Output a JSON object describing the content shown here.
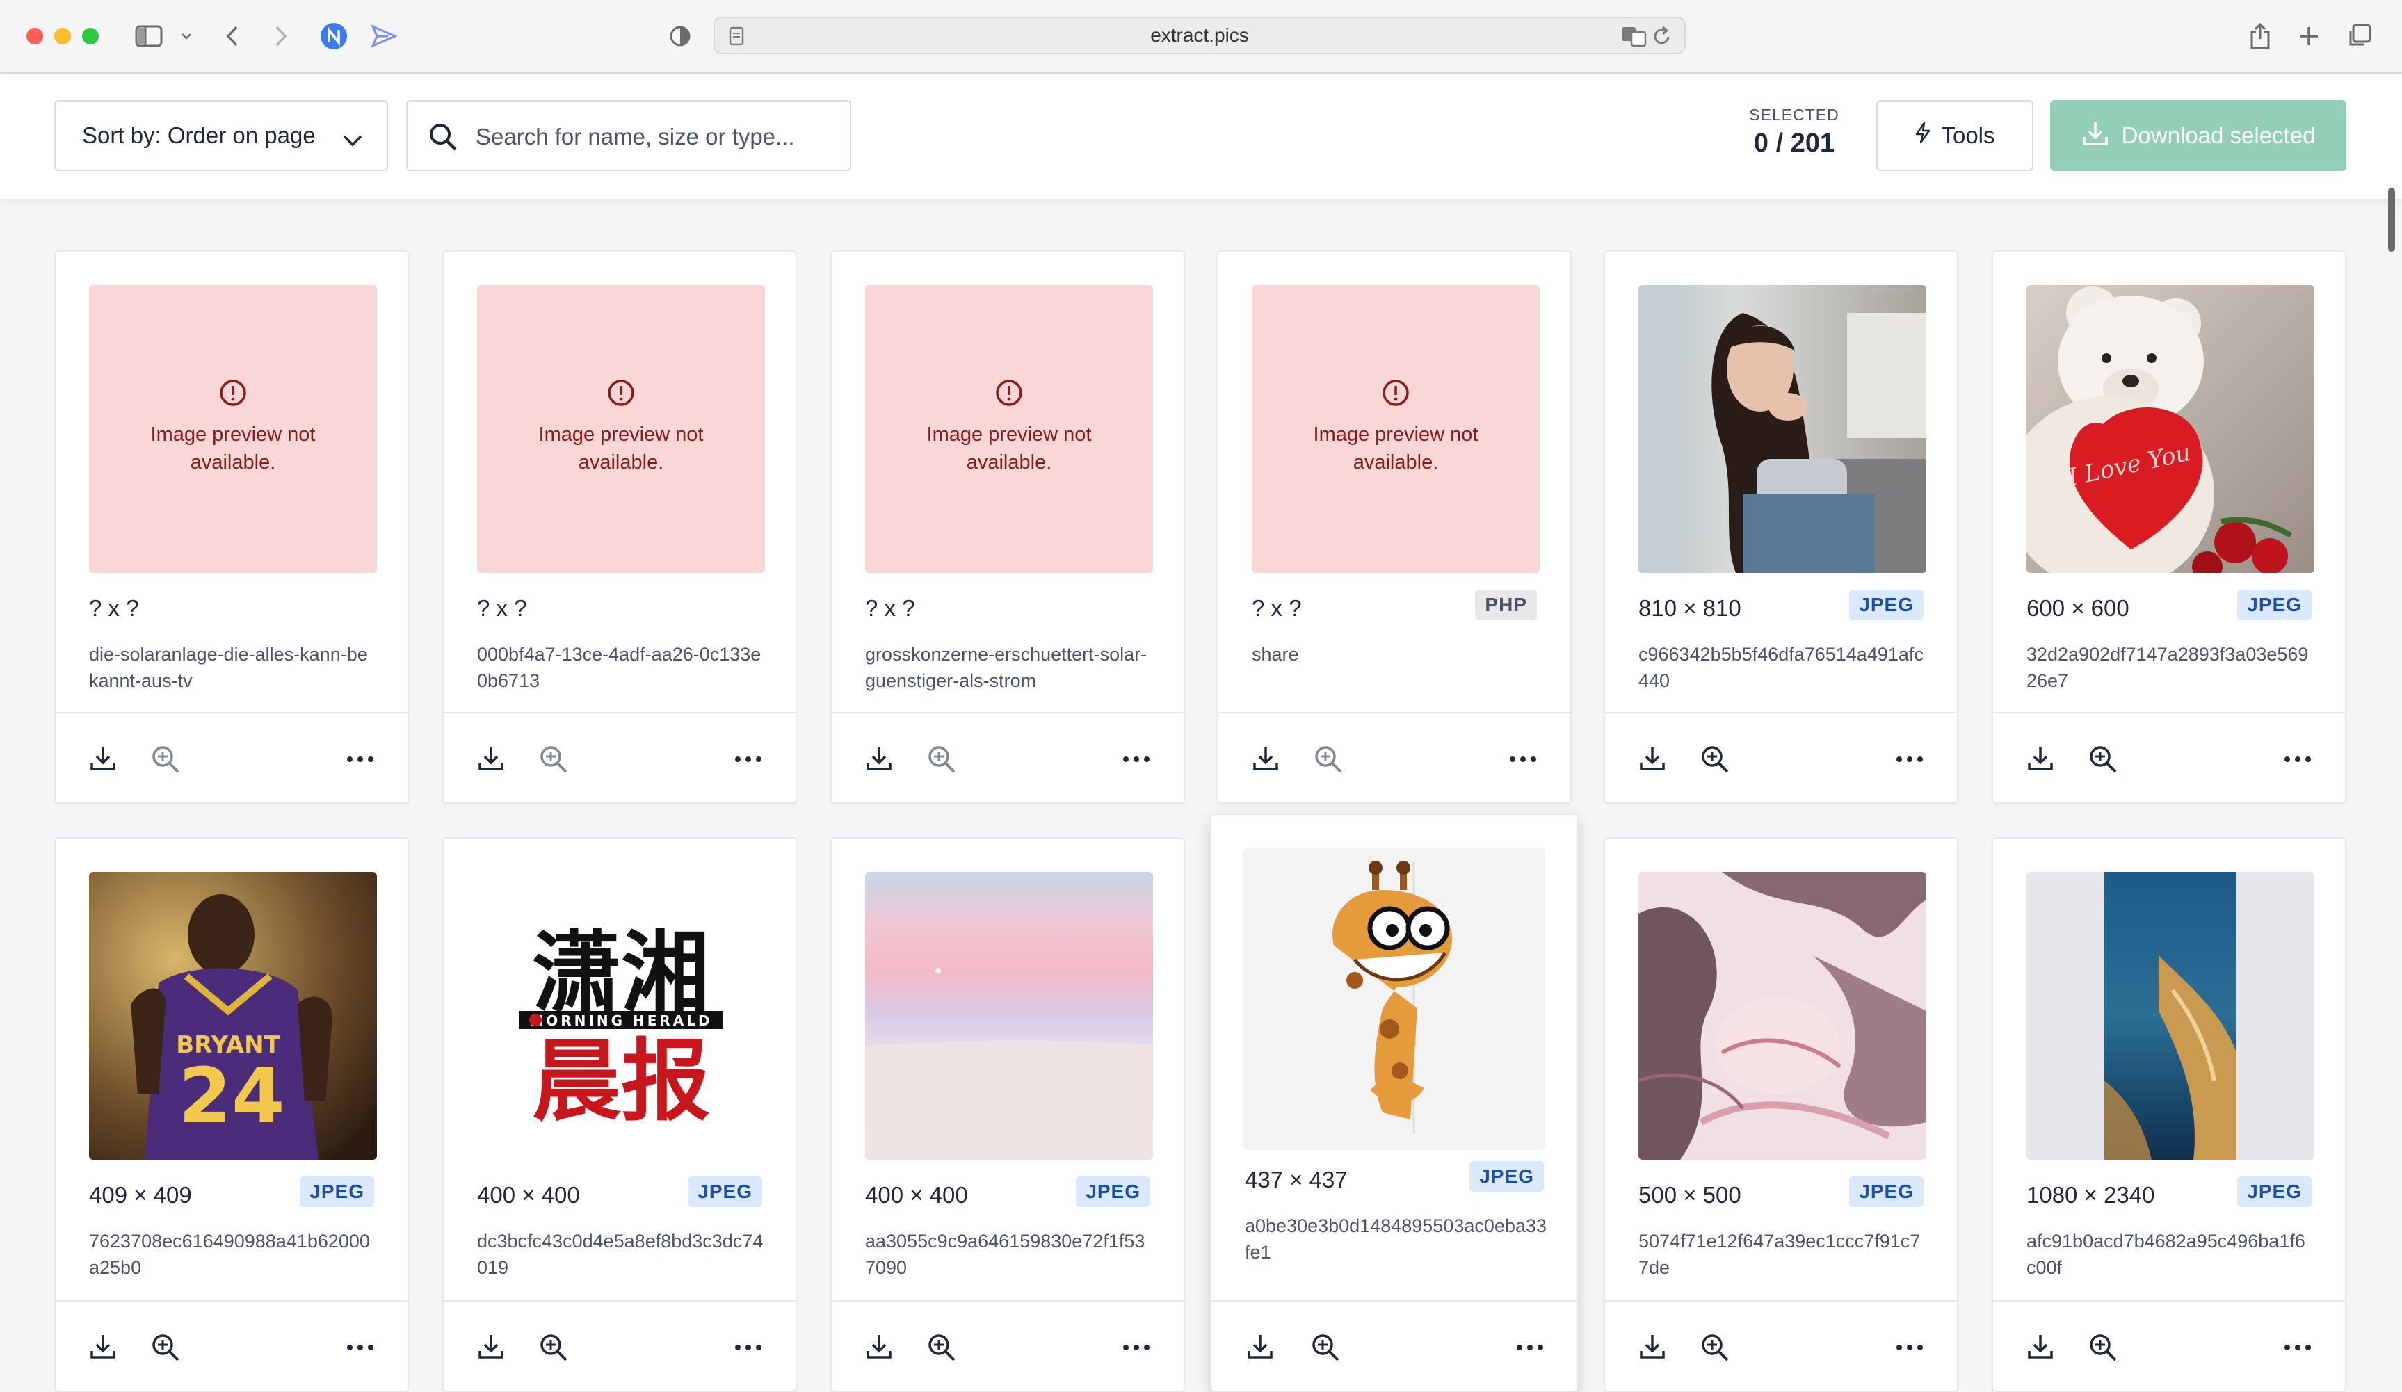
{
  "browser": {
    "url": "extract.pics"
  },
  "toolbar": {
    "sort_label": "Sort by: Order on page",
    "search_placeholder": "Search for name, size or type...",
    "selected_label": "SELECTED",
    "selected_value": "0 / 201",
    "tools_label": "Tools",
    "download_label": "Download selected"
  },
  "error_text": "Image preview not available.",
  "cards": [
    {
      "dims": "? x ?",
      "name": "die-solaranlage-die-alles-kann-bekannt-aus-tv",
      "badge": ""
    },
    {
      "dims": "? x ?",
      "name": "000bf4a7-13ce-4adf-aa26-0c133e0b6713",
      "badge": ""
    },
    {
      "dims": "? x ?",
      "name": "grosskonzerne-erschuettert-solar-guenstiger-als-strom",
      "badge": ""
    },
    {
      "dims": "? x ?",
      "name": "share",
      "badge": "PHP"
    },
    {
      "dims": "810 × 810",
      "name": "c966342b5b5f46dfa76514a491afc440",
      "badge": "JPEG"
    },
    {
      "dims": "600 × 600",
      "name": "32d2a902df7147a2893f3a03e56926e7",
      "badge": "JPEG"
    },
    {
      "dims": "409 × 409",
      "name": "7623708ec616490988a41b62000a25b0",
      "badge": "JPEG"
    },
    {
      "dims": "400 × 400",
      "name": "dc3bcfc43c0d4e5a8ef8bd3c3dc74019",
      "badge": "JPEG"
    },
    {
      "dims": "400 × 400",
      "name": "aa3055c9c9a646159830e72f1f537090",
      "badge": "JPEG"
    },
    {
      "dims": "437 × 437",
      "name": "a0be30e3b0d1484895503ac0eba33fe1",
      "badge": "JPEG"
    },
    {
      "dims": "500 × 500",
      "name": "5074f71e12f647a39ec1ccc7f91c77de",
      "badge": "JPEG"
    },
    {
      "dims": "1080 × 2340",
      "name": "afc91b0acd7b4682a95c496ba1f6c00f",
      "badge": "JPEG"
    }
  ],
  "images": {
    "teddy_text": "I Love You",
    "jersey_number": "24",
    "jersey_name": "BRYANT",
    "newspaper_top": "潇湘",
    "newspaper_band": "MORNING HERALD",
    "newspaper_bottom": "晨报"
  }
}
